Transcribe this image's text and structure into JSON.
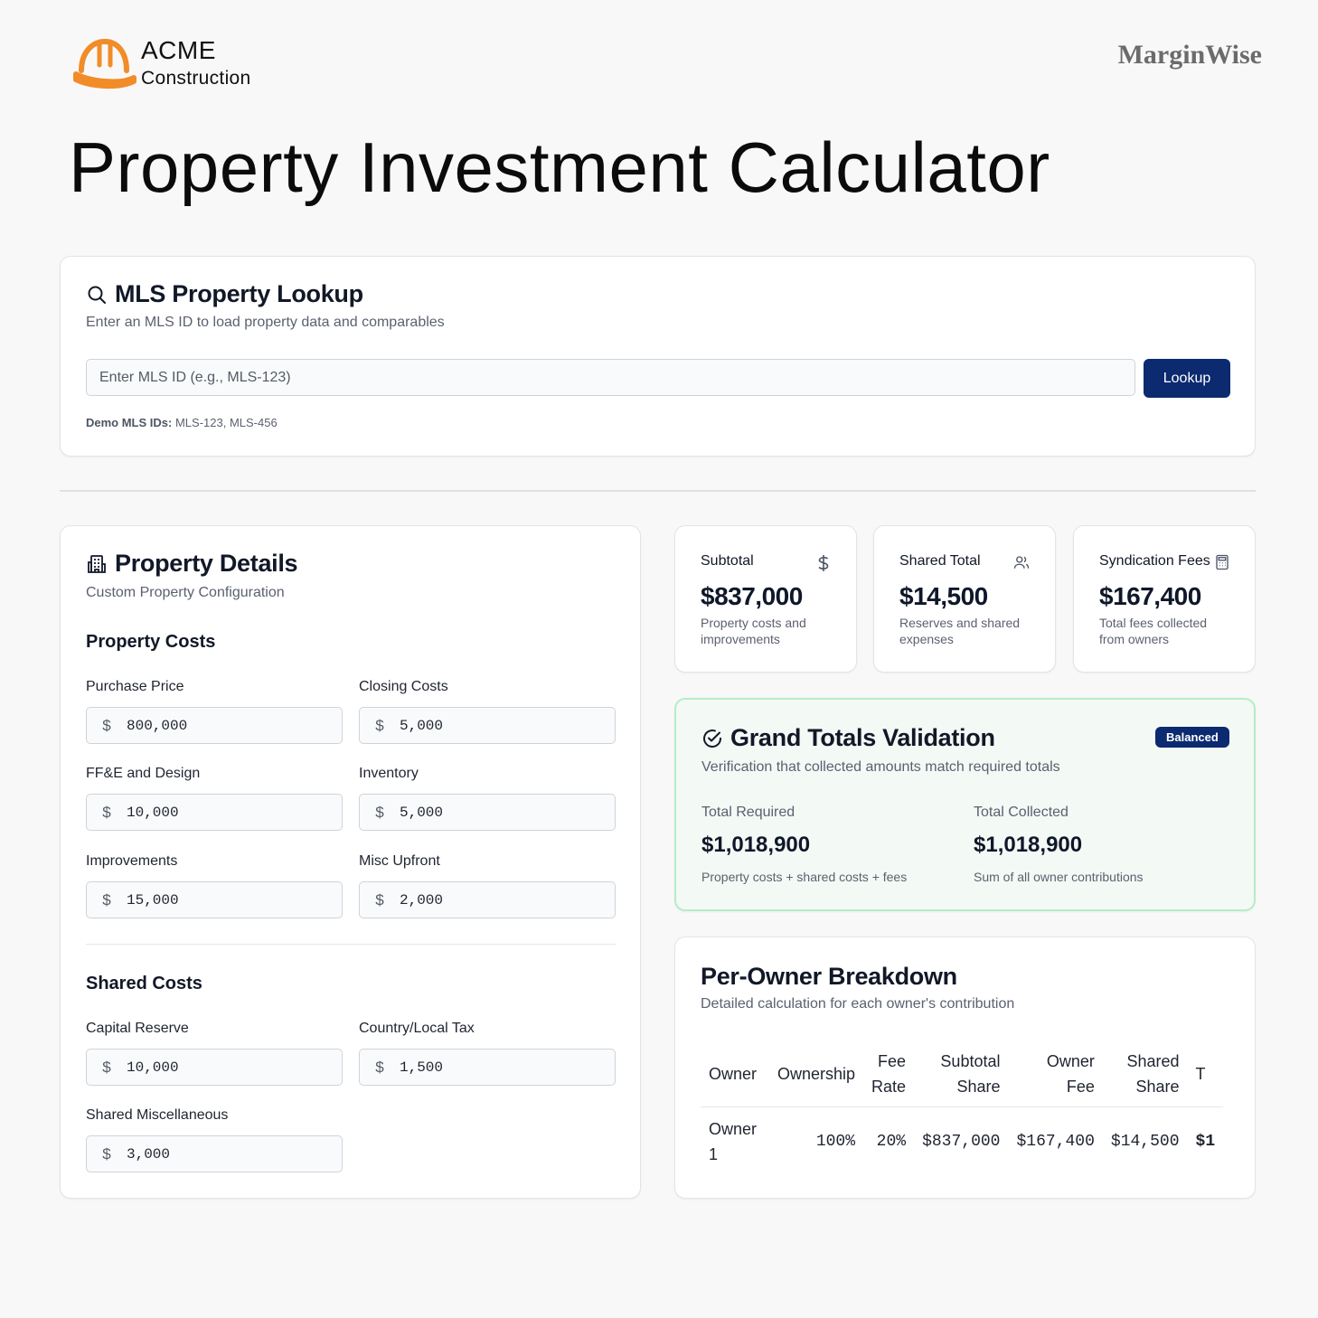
{
  "brand": {
    "name": "ACME",
    "subtitle": "Construction",
    "partner": "MarginWise"
  },
  "page": {
    "title": "Property Investment Calculator"
  },
  "mls": {
    "title": "MLS Property Lookup",
    "description": "Enter an MLS ID to load property data and comparables",
    "placeholder": "Enter MLS ID (e.g., MLS-123)",
    "value": "",
    "button": "Lookup",
    "demo_label": "Demo MLS IDs:",
    "demo_ids": "MLS-123, MLS-456"
  },
  "details": {
    "title": "Property Details",
    "subtitle": "Custom Property Configuration",
    "property_costs": {
      "heading": "Property Costs",
      "fields": [
        {
          "label": "Purchase Price",
          "currency": "$",
          "value": "800,000"
        },
        {
          "label": "Closing Costs",
          "currency": "$",
          "value": "5,000"
        },
        {
          "label": "FF&E and Design",
          "currency": "$",
          "value": "10,000"
        },
        {
          "label": "Inventory",
          "currency": "$",
          "value": "5,000"
        },
        {
          "label": "Improvements",
          "currency": "$",
          "value": "15,000"
        },
        {
          "label": "Misc Upfront",
          "currency": "$",
          "value": "2,000"
        }
      ]
    },
    "shared_costs": {
      "heading": "Shared Costs",
      "fields": [
        {
          "label": "Capital Reserve",
          "currency": "$",
          "value": "10,000"
        },
        {
          "label": "Country/Local Tax",
          "currency": "$",
          "value": "1,500"
        },
        {
          "label": "Shared Miscellaneous",
          "currency": "$",
          "value": "3,000"
        }
      ]
    }
  },
  "stats": [
    {
      "title": "Subtotal",
      "icon": "dollar-icon",
      "value": "$837,000",
      "sub": "Property costs and improvements"
    },
    {
      "title": "Shared Total",
      "icon": "users-icon",
      "value": "$14,500",
      "sub": "Reserves and shared expenses"
    },
    {
      "title": "Syndication Fees",
      "icon": "calculator-icon",
      "value": "$167,400",
      "sub": "Total fees collected from owners"
    }
  ],
  "grand": {
    "title": "Grand Totals Validation",
    "description": "Verification that collected amounts match required totals",
    "badge": "Balanced",
    "required_label": "Total Required",
    "required_value": "$1,018,900",
    "required_sub": "Property costs + shared costs + fees",
    "collected_label": "Total Collected",
    "collected_value": "$1,018,900",
    "collected_sub": "Sum of all owner contributions"
  },
  "owners": {
    "title": "Per-Owner Breakdown",
    "description": "Detailed calculation for each owner's contribution",
    "headers": [
      "Owner",
      "Ownership",
      "Fee Rate",
      "Subtotal Share",
      "Owner Fee",
      "Shared Share",
      "T"
    ],
    "rows": [
      [
        "Owner 1",
        "100%",
        "20%",
        "$837,000",
        "$167,400",
        "$14,500",
        "$1"
      ]
    ]
  },
  "colors": {
    "brand_orange": "#f28c28",
    "primary": "#0b2a6f",
    "success_border": "#b7ecc7"
  }
}
